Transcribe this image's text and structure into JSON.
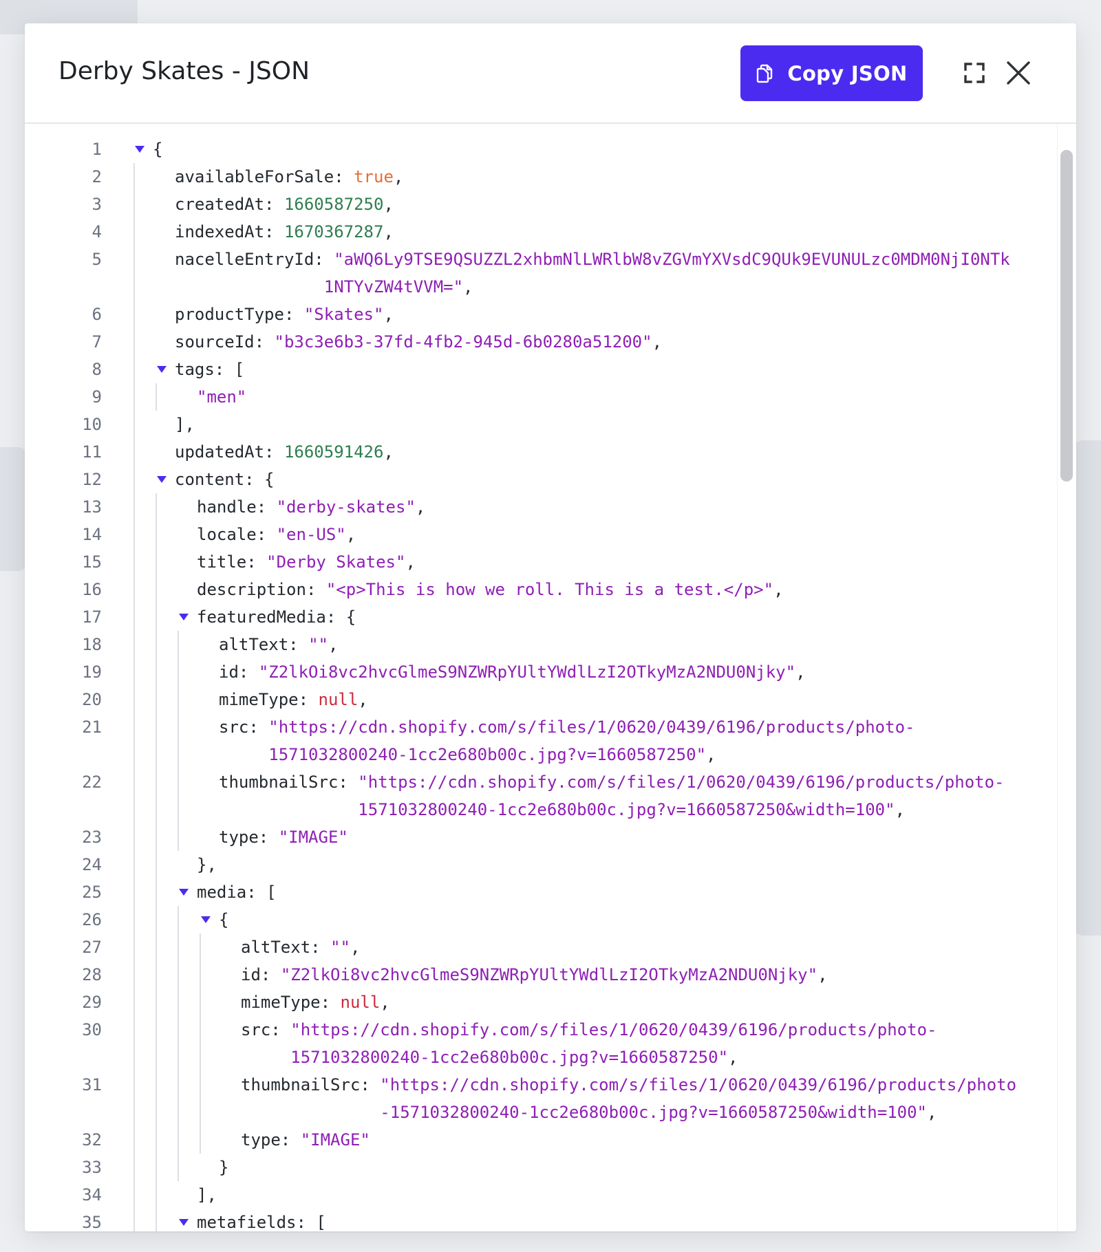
{
  "modal": {
    "title": "Derby Skates - JSON",
    "copy_button_label": "Copy JSON",
    "accent_color": "#4c2bf0",
    "icons": {
      "copy": "copy-icon",
      "expand": "fullscreen-expand-icon",
      "close": "close-icon"
    }
  },
  "syntax_colors": {
    "string": "#8f1fb5",
    "number": "#2e7d4f",
    "boolean": "#e46f33",
    "null": "#cc2b3d",
    "key": "#24292f"
  },
  "code_lines": [
    {
      "num": "1",
      "depth": 0,
      "fold": true,
      "tokens": [
        [
          "p",
          "{"
        ]
      ]
    },
    {
      "num": "2",
      "depth": 1,
      "tokens": [
        [
          "k",
          "availableForSale"
        ],
        [
          "p",
          ": "
        ],
        [
          "b",
          "true"
        ],
        [
          "p",
          ","
        ]
      ]
    },
    {
      "num": "3",
      "depth": 1,
      "tokens": [
        [
          "k",
          "createdAt"
        ],
        [
          "p",
          ": "
        ],
        [
          "n",
          "1660587250"
        ],
        [
          "p",
          ","
        ]
      ]
    },
    {
      "num": "4",
      "depth": 1,
      "tokens": [
        [
          "k",
          "indexedAt"
        ],
        [
          "p",
          ": "
        ],
        [
          "n",
          "1670367287"
        ],
        [
          "p",
          ","
        ]
      ]
    },
    {
      "num": "5",
      "depth": 1,
      "tokens": [
        [
          "k",
          "nacelleEntryId"
        ],
        [
          "p",
          ": "
        ],
        [
          "s",
          "\"aWQ6Ly9TSE9QSUZZL2xhbmNlLWRlbW8vZGVmYXVsdC9QUk9EVUNULzc0MDM0NjI0NTk"
        ]
      ]
    },
    {
      "num": "",
      "depth": 1,
      "indent": 15,
      "tokens": [
        [
          "s",
          "1NTYvZW4tVVM=\""
        ],
        [
          "p",
          ","
        ]
      ]
    },
    {
      "num": "6",
      "depth": 1,
      "tokens": [
        [
          "k",
          "productType"
        ],
        [
          "p",
          ": "
        ],
        [
          "s",
          "\"Skates\""
        ],
        [
          "p",
          ","
        ]
      ]
    },
    {
      "num": "7",
      "depth": 1,
      "tokens": [
        [
          "k",
          "sourceId"
        ],
        [
          "p",
          ": "
        ],
        [
          "s",
          "\"b3c3e6b3-37fd-4fb2-945d-6b0280a51200\""
        ],
        [
          "p",
          ","
        ]
      ]
    },
    {
      "num": "8",
      "depth": 1,
      "fold": true,
      "tokens": [
        [
          "k",
          "tags"
        ],
        [
          "p",
          ": ["
        ]
      ]
    },
    {
      "num": "9",
      "depth": 2,
      "tokens": [
        [
          "s",
          "\"men\""
        ]
      ]
    },
    {
      "num": "10",
      "depth": 1,
      "tokens": [
        [
          "p",
          "],"
        ]
      ]
    },
    {
      "num": "11",
      "depth": 1,
      "tokens": [
        [
          "k",
          "updatedAt"
        ],
        [
          "p",
          ": "
        ],
        [
          "n",
          "1660591426"
        ],
        [
          "p",
          ","
        ]
      ]
    },
    {
      "num": "12",
      "depth": 1,
      "fold": true,
      "tokens": [
        [
          "k",
          "content"
        ],
        [
          "p",
          ": {"
        ]
      ]
    },
    {
      "num": "13",
      "depth": 2,
      "tokens": [
        [
          "k",
          "handle"
        ],
        [
          "p",
          ": "
        ],
        [
          "s",
          "\"derby-skates\""
        ],
        [
          "p",
          ","
        ]
      ]
    },
    {
      "num": "14",
      "depth": 2,
      "tokens": [
        [
          "k",
          "locale"
        ],
        [
          "p",
          ": "
        ],
        [
          "s",
          "\"en-US\""
        ],
        [
          "p",
          ","
        ]
      ]
    },
    {
      "num": "15",
      "depth": 2,
      "tokens": [
        [
          "k",
          "title"
        ],
        [
          "p",
          ": "
        ],
        [
          "s",
          "\"Derby Skates\""
        ],
        [
          "p",
          ","
        ]
      ]
    },
    {
      "num": "16",
      "depth": 2,
      "tokens": [
        [
          "k",
          "description"
        ],
        [
          "p",
          ": "
        ],
        [
          "s",
          "\"<p>This is how we roll. This is a test.</p>\""
        ],
        [
          "p",
          ","
        ]
      ]
    },
    {
      "num": "17",
      "depth": 2,
      "fold": true,
      "tokens": [
        [
          "k",
          "featuredMedia"
        ],
        [
          "p",
          ": {"
        ]
      ]
    },
    {
      "num": "18",
      "depth": 3,
      "tokens": [
        [
          "k",
          "altText"
        ],
        [
          "p",
          ": "
        ],
        [
          "s",
          "\"\""
        ],
        [
          "p",
          ","
        ]
      ]
    },
    {
      "num": "19",
      "depth": 3,
      "tokens": [
        [
          "k",
          "id"
        ],
        [
          "p",
          ": "
        ],
        [
          "s",
          "\"Z2lkOi8vc2hvcGlmeS9NZWRpYUltYWdlLzI2OTkyMzA2NDU0Njky\""
        ],
        [
          "p",
          ","
        ]
      ]
    },
    {
      "num": "20",
      "depth": 3,
      "tokens": [
        [
          "k",
          "mimeType"
        ],
        [
          "p",
          ": "
        ],
        [
          "u",
          "null"
        ],
        [
          "p",
          ","
        ]
      ]
    },
    {
      "num": "21",
      "depth": 3,
      "tokens": [
        [
          "k",
          "src"
        ],
        [
          "p",
          ": "
        ],
        [
          "s",
          "\"https://cdn.shopify.com/s/files/1/0620/0439/6196/products/photo-"
        ]
      ]
    },
    {
      "num": "",
      "depth": 3,
      "indent": 5,
      "tokens": [
        [
          "s",
          "1571032800240-1cc2e680b00c.jpg?v=1660587250\""
        ],
        [
          "p",
          ","
        ]
      ]
    },
    {
      "num": "22",
      "depth": 3,
      "tokens": [
        [
          "k",
          "thumbnailSrc"
        ],
        [
          "p",
          ": "
        ],
        [
          "s",
          "\"https://cdn.shopify.com/s/files/1/0620/0439/6196/products/photo-"
        ]
      ]
    },
    {
      "num": "",
      "depth": 3,
      "indent": 14,
      "tokens": [
        [
          "s",
          "1571032800240-1cc2e680b00c.jpg?v=1660587250&width=100\""
        ],
        [
          "p",
          ","
        ]
      ]
    },
    {
      "num": "23",
      "depth": 3,
      "tokens": [
        [
          "k",
          "type"
        ],
        [
          "p",
          ": "
        ],
        [
          "s",
          "\"IMAGE\""
        ]
      ]
    },
    {
      "num": "24",
      "depth": 2,
      "tokens": [
        [
          "p",
          "},"
        ]
      ]
    },
    {
      "num": "25",
      "depth": 2,
      "fold": true,
      "tokens": [
        [
          "k",
          "media"
        ],
        [
          "p",
          ": ["
        ]
      ]
    },
    {
      "num": "26",
      "depth": 3,
      "fold": true,
      "tokens": [
        [
          "p",
          "{"
        ]
      ]
    },
    {
      "num": "27",
      "depth": 4,
      "tokens": [
        [
          "k",
          "altText"
        ],
        [
          "p",
          ": "
        ],
        [
          "s",
          "\"\""
        ],
        [
          "p",
          ","
        ]
      ]
    },
    {
      "num": "28",
      "depth": 4,
      "tokens": [
        [
          "k",
          "id"
        ],
        [
          "p",
          ": "
        ],
        [
          "s",
          "\"Z2lkOi8vc2hvcGlmeS9NZWRpYUltYWdlLzI2OTkyMzA2NDU0Njky\""
        ],
        [
          "p",
          ","
        ]
      ]
    },
    {
      "num": "29",
      "depth": 4,
      "tokens": [
        [
          "k",
          "mimeType"
        ],
        [
          "p",
          ": "
        ],
        [
          "u",
          "null"
        ],
        [
          "p",
          ","
        ]
      ]
    },
    {
      "num": "30",
      "depth": 4,
      "tokens": [
        [
          "k",
          "src"
        ],
        [
          "p",
          ": "
        ],
        [
          "s",
          "\"https://cdn.shopify.com/s/files/1/0620/0439/6196/products/photo-"
        ]
      ]
    },
    {
      "num": "",
      "depth": 4,
      "indent": 5,
      "tokens": [
        [
          "s",
          "1571032800240-1cc2e680b00c.jpg?v=1660587250\""
        ],
        [
          "p",
          ","
        ]
      ]
    },
    {
      "num": "31",
      "depth": 4,
      "tokens": [
        [
          "k",
          "thumbnailSrc"
        ],
        [
          "p",
          ": "
        ],
        [
          "s",
          "\"https://cdn.shopify.com/s/files/1/0620/0439/6196/products/photo"
        ]
      ]
    },
    {
      "num": "",
      "depth": 4,
      "indent": 14,
      "tokens": [
        [
          "s",
          "-1571032800240-1cc2e680b00c.jpg?v=1660587250&width=100\""
        ],
        [
          "p",
          ","
        ]
      ]
    },
    {
      "num": "32",
      "depth": 4,
      "tokens": [
        [
          "k",
          "type"
        ],
        [
          "p",
          ": "
        ],
        [
          "s",
          "\"IMAGE\""
        ]
      ]
    },
    {
      "num": "33",
      "depth": 3,
      "tokens": [
        [
          "p",
          "}"
        ]
      ]
    },
    {
      "num": "34",
      "depth": 2,
      "tokens": [
        [
          "p",
          "],"
        ]
      ]
    },
    {
      "num": "35",
      "depth": 2,
      "fold": true,
      "tokens": [
        [
          "k",
          "metafields"
        ],
        [
          "p",
          ": ["
        ]
      ]
    }
  ]
}
